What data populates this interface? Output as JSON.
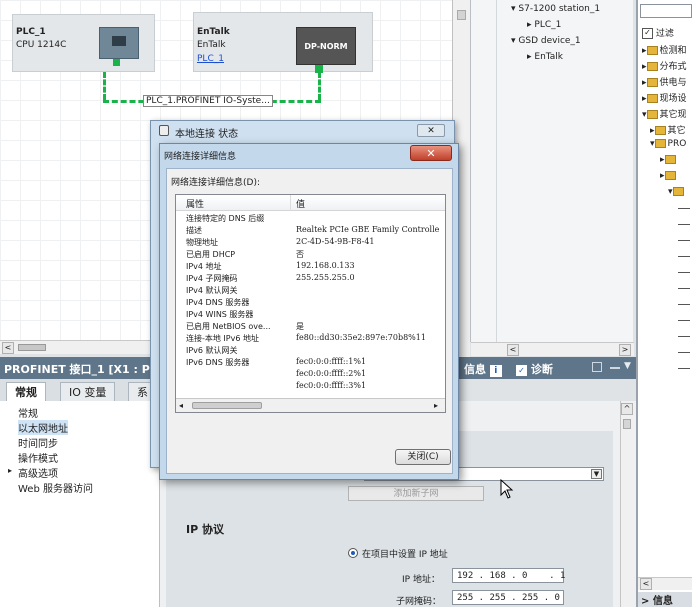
{
  "network": {
    "plc": {
      "name": "PLC_1",
      "cpu": "CPU 1214C"
    },
    "entalk": {
      "name": "EnTalk",
      "sub": "EnTalk",
      "link": "PLC_1",
      "module": "DP-NORM"
    },
    "subnet_label": "PLC_1.PROFINET IO-Syste..."
  },
  "tree": {
    "items": [
      "S7-1200 station_1",
      "PLC_1",
      "GSD device_1",
      "EnTalk"
    ]
  },
  "catalog": {
    "filter_label": "过滤",
    "items": [
      "检测和",
      "分布式",
      "供电与",
      "现场设",
      "其它现",
      "其它",
      "PRO"
    ]
  },
  "inspector": {
    "title": "PROFINET 接口_1 [X1 : PN",
    "tabs": [
      "常规",
      "IO 变量",
      "系"
    ],
    "nav": [
      "常规",
      "以太网地址",
      "时间同步",
      "操作模式",
      "高级选项",
      "Web 服务器访问"
    ],
    "info_tab": "信息",
    "diag_tab": "诊断",
    "add_subnet": "添加新子网",
    "ip_protocol": "IP 协议",
    "ip_option": "在项目中设置 IP 地址",
    "ip_label": "IP 地址：",
    "ip_value": "192 . 168 . 0    . 1",
    "mask_label": "子网掩码：",
    "mask_value": "255 . 255 . 255 . 0"
  },
  "status_dialog": {
    "title": "本地连接 状态"
  },
  "detail_dialog": {
    "title": "网络连接详细信息",
    "caption": "网络连接详细信息(D):",
    "col_property": "属性",
    "col_value": "值",
    "rows": [
      {
        "k": "连接特定的 DNS 后缀",
        "v": ""
      },
      {
        "k": "描述",
        "v": "Realtek PCIe GBE Family Controlle"
      },
      {
        "k": "物理地址",
        "v": "2C-4D-54-9B-F8-41"
      },
      {
        "k": "已启用 DHCP",
        "v": "否"
      },
      {
        "k": "IPv4 地址",
        "v": "192.168.0.133"
      },
      {
        "k": "IPv4 子网掩码",
        "v": "255.255.255.0"
      },
      {
        "k": "IPv4 默认网关",
        "v": ""
      },
      {
        "k": "IPv4 DNS 服务器",
        "v": ""
      },
      {
        "k": "IPv4 WINS 服务器",
        "v": ""
      },
      {
        "k": "已启用 NetBIOS ove...",
        "v": "是"
      },
      {
        "k": "连接-本地 IPv6 地址",
        "v": "fe80::dd30:35e2:897e:70b8%11"
      },
      {
        "k": "IPv6 默认网关",
        "v": ""
      },
      {
        "k": "IPv6 DNS 服务器",
        "v": "fec0:0:0:ffff::1%1"
      },
      {
        "k": "",
        "v": "fec0:0:0:ffff::2%1"
      },
      {
        "k": "",
        "v": "fec0:0:0:ffff::3%1"
      }
    ],
    "close_button": "关闭(C)"
  }
}
